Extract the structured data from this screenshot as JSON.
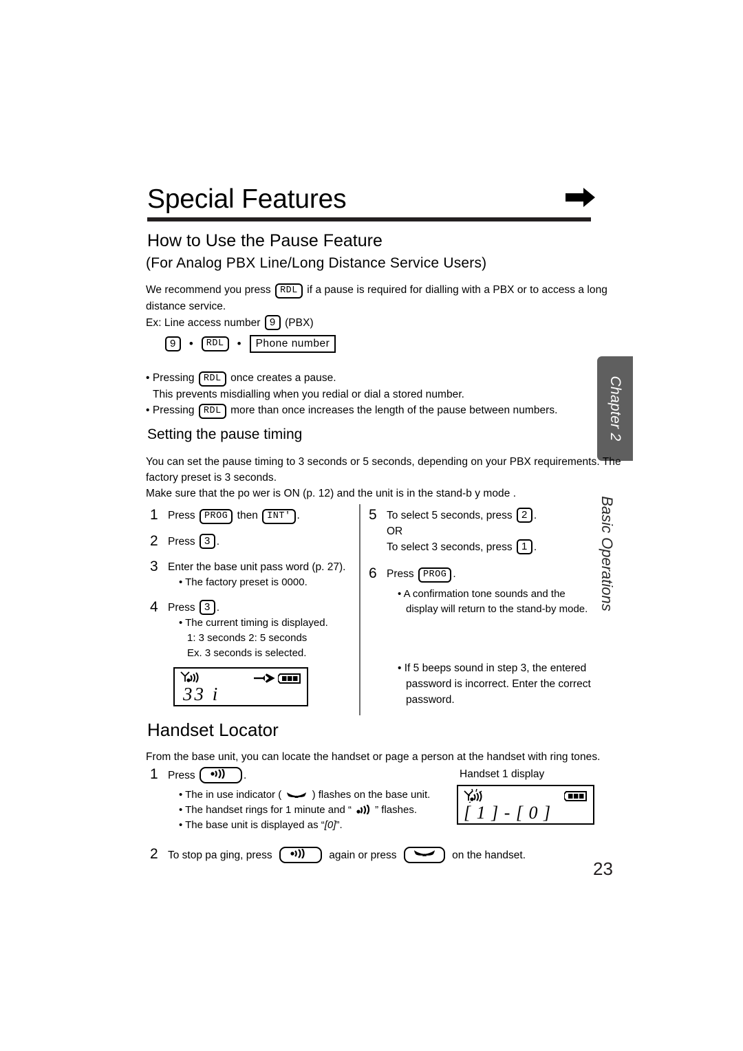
{
  "page": {
    "number": "23",
    "chapter_tab": "Chapter 2",
    "chapter_subtitle": "Basic Operations"
  },
  "heading": {
    "title": "Special Features",
    "arrow_icon": "right-arrow-icon"
  },
  "section_pause": {
    "title": "How to Use the Pause Feature",
    "subtitle": "(For Analog PBX Line/Long Distance Service Users)",
    "intro_line1_a": "We recommend you press",
    "intro_key": "RDL",
    "intro_line1_b": "if a pause is required for dialling with a PBX or to access a long",
    "intro_line2": "distance service.",
    "example_label_a": "Ex: Line access number",
    "example_key": "9",
    "example_label_b": "(PBX)",
    "sequence": {
      "key1": "9",
      "sep1": "•",
      "key2": "RDL",
      "sep2": "•",
      "key3": "Phone number"
    },
    "bullets": [
      {
        "pre": "Pressing",
        "key": "RDL",
        "post": "once creates a pause.",
        "second_line": "This prevents misdialling when you redial or dial a stored number."
      },
      {
        "pre": "Pressing",
        "key": "RDL",
        "post": "more than once increases the length of the pause between numbers.",
        "second_line": ""
      }
    ]
  },
  "section_timing": {
    "title": "Setting the pause timing",
    "para_line1": "You can set the pause timing to 3 seconds or 5 seconds, depending on your PBX requirements. The",
    "para_line2": "factory preset is 3 seconds.",
    "para_line3": "Make sure that the po  wer is ON (p.  12) and the unit is in the stand-b   y mode .",
    "steps_left": [
      {
        "num": "1",
        "text_a": "Press",
        "key_a": "PROG",
        "text_b": "then",
        "key_b": "INT'",
        "text_c": "."
      },
      {
        "num": "2",
        "text_a": "Press",
        "key_a": "3",
        "text_c": "."
      },
      {
        "num": "3",
        "text_a": "Enter the base unit pass  word (p.  27).",
        "subs": [
          "• The factory preset is 0000."
        ]
      },
      {
        "num": "4",
        "text_a": "Press",
        "key_a": "3",
        "text_c": ".",
        "subs": [
          "• The current timing is displayed.",
          "1: 3 seconds     2: 5 seconds",
          "Ex. 3 seconds is selected."
        ]
      }
    ],
    "steps_right": [
      {
        "num": "5",
        "line1_a": "To select 5 seconds,  press",
        "key1": "2",
        "line1_b": ".",
        "line2": "OR",
        "line3_a": "To select 3 seconds,  press",
        "key2": "1",
        "line3_b": "."
      },
      {
        "num": "6",
        "text_a": "Press",
        "key_a": "PROG",
        "text_c": ".",
        "subs": [
          "• A confirmation tone sounds and the",
          "display will return to the stand-by mode."
        ]
      }
    ],
    "note_right": [
      "• If 5 beeps sound in step 3, the entered",
      "password is incorrect. Enter the correct",
      "password."
    ],
    "lcd_display": {
      "antenna_icon": "antenna-signal-icon",
      "arrow_icon": "right-arrow-outline-icon",
      "battery_icon": "battery-full-icon",
      "text": "33  i"
    }
  },
  "section_locator": {
    "title": "Handset Locator",
    "intro": "From the base unit, you can locate the handset or page a person at the handset with ring tones.",
    "caption_handset_display": "Handset 1 display",
    "steps": [
      {
        "num": "1",
        "text_a": "Press",
        "key_icon": "page-speaker-icon",
        "text_c": ".",
        "bullets": [
          {
            "pre": "• The in use indicator (",
            "icon": "handset-in-use-icon",
            "post": ") flashes on the base unit."
          },
          {
            "pre": "• The handset rings for 1 minute and “",
            "icon": "ringing-waves-icon",
            "post": "” flashes."
          },
          {
            "pre": "• The base unit is displayed as “",
            "italic": "[0]",
            "post": "”."
          }
        ]
      },
      {
        "num": "2",
        "text_a": "To stop pa ging,  press",
        "key_icon_1": "page-speaker-icon",
        "text_b": "again or press",
        "key_icon_2": "handset-in-use-icon",
        "text_c": "on the handset."
      }
    ],
    "lcd_display": {
      "antenna_icon": "antenna-signal-flashing-icon",
      "battery_icon": "battery-full-icon",
      "text": "[ 1 ] - [ 0 ]"
    }
  }
}
